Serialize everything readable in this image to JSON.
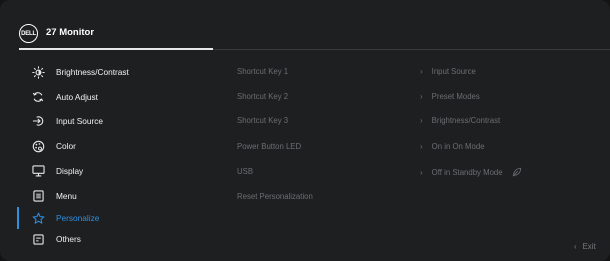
{
  "header": {
    "logo_text": "DELL",
    "title": "27 Monitor"
  },
  "menu": {
    "items": [
      {
        "label": "Brightness/Contrast",
        "icon": "brightness-icon"
      },
      {
        "label": "Auto Adjust",
        "icon": "auto-adjust-icon"
      },
      {
        "label": "Input Source",
        "icon": "input-source-icon"
      },
      {
        "label": "Color",
        "icon": "color-icon"
      },
      {
        "label": "Display",
        "icon": "display-icon"
      },
      {
        "label": "Menu",
        "icon": "menu-icon"
      },
      {
        "label": "Personalize",
        "icon": "star-icon",
        "active": true
      },
      {
        "label": "Others",
        "icon": "others-icon"
      }
    ]
  },
  "options": [
    {
      "label": "Shortcut Key 1",
      "value": "Input Source"
    },
    {
      "label": "Shortcut Key 2",
      "value": "Preset Modes"
    },
    {
      "label": "Shortcut Key 3",
      "value": "Brightness/Contrast"
    },
    {
      "label": "Power Button LED",
      "value": "On in On Mode"
    },
    {
      "label": "USB",
      "value": "Off in Standby Mode"
    },
    {
      "label": "Reset Personalization",
      "value": ""
    }
  ],
  "footer": {
    "exit_label": "Exit"
  },
  "colors": {
    "accent": "#2f8fe0",
    "background": "#1e1f21",
    "disabled_text": "#6c6d70"
  }
}
